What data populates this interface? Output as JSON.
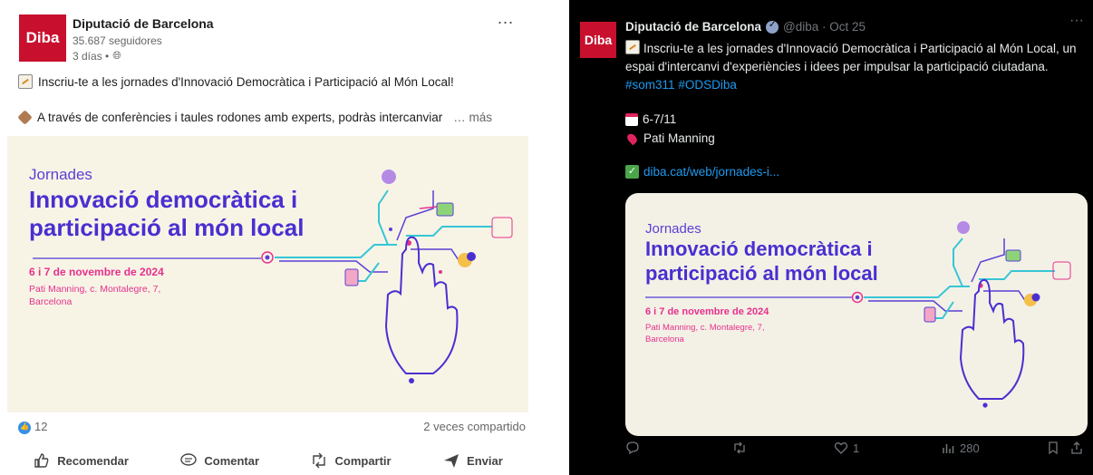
{
  "linkedin": {
    "org_logo": "Diba",
    "org_name": "Diputació de Barcelona",
    "followers": "35.687 seguidores",
    "time": "3 días •",
    "more_icon": "...",
    "line1": "Inscriu-te a les jornades d'Innovació Democràtica i Participació al Món Local!",
    "line2": "A través de conferències i taules rodones amb experts, podràs intercanviar",
    "see_more": "… más",
    "reactions_count": "12",
    "shares": "2 veces compartido",
    "actions": {
      "like": "Recomendar",
      "comment": "Comentar",
      "share": "Compartir",
      "send": "Enviar"
    }
  },
  "banner": {
    "kicker": "Jornades",
    "title_line1": "Innovació democràtica i",
    "title_line2": "participació al món local",
    "date": "6 i 7 de novembre de 2024",
    "place_line1": "Pati Manning, c. Montalegre, 7,",
    "place_line2": "Barcelona",
    "colors": {
      "purple": "#4a2fd0",
      "pink": "#e8308c",
      "teal": "#37c6d6",
      "bg": "#f7f4e6"
    }
  },
  "x": {
    "org_logo": "Diba",
    "org_name": "Diputació de Barcelona",
    "handle": "@diba · Oct 25",
    "more_icon": "···",
    "text": "Inscriu-te a les jornades d'Innovació Democràtica i Participació al Món Local, un espai d'intercanvi d'experiències i idees per impulsar la participació ciutadana.",
    "hashtag1": "#som311",
    "hashtag2": "#ODSDiba",
    "dates": "6-7/11",
    "place": "Pati Manning",
    "link": "diba.cat/web/jornades-i...",
    "likes": "1",
    "views": "280"
  }
}
